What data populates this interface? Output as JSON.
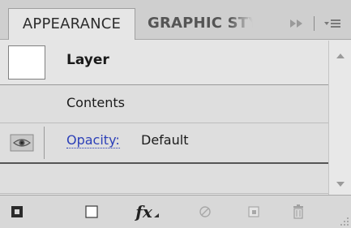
{
  "tabs": {
    "active_label": "APPEARANCE",
    "inactive_label": "GRAPHIC STY"
  },
  "icons": {
    "collapse": "double-chevron-right-icon",
    "panel_menu": "panel-menu-icon",
    "visibility": "eye-icon"
  },
  "rows": {
    "layer": {
      "label": "Layer"
    },
    "contents": {
      "label": "Contents"
    },
    "opacity": {
      "link": "Opacity:",
      "value": "Default"
    }
  },
  "toolbar": {
    "fx_label": "fx"
  },
  "colors": {
    "link": "#2b3fb8",
    "panel_bg": "#e5e5e5",
    "tab_bar_bg": "#cfcfcf"
  }
}
